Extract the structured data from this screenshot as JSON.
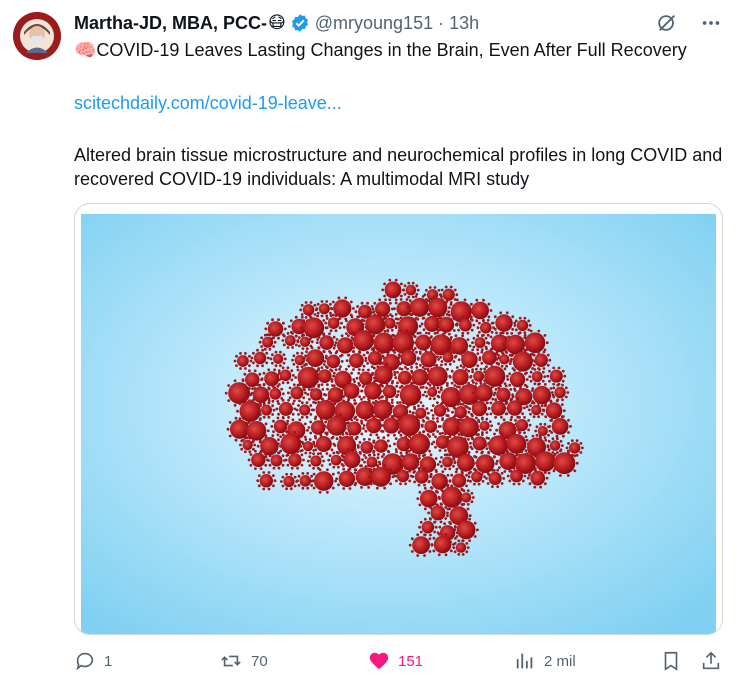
{
  "author": {
    "name": "Martha-JD, MBA, PCC-",
    "emoji": "😷",
    "handle": "@mryoung151",
    "time": "· 13h"
  },
  "tweet": {
    "title": "🧠COVID-19 Leaves Lasting Changes in the Brain, Even After Full Recovery",
    "link": "scitechdaily.com/covid-19-leave...",
    "body": "Altered brain tissue microstructure and neurochemical profiles in long COVID and recovered COVID-19 individuals: A multimodal MRI study"
  },
  "actions": {
    "replies": "1",
    "reposts": "70",
    "likes": "151",
    "views": "2 mil"
  },
  "colors": {
    "link": "#1d9bf0",
    "like": "#f91880",
    "virus": "#b3171c",
    "sky": "#7fd0f2"
  },
  "icons": [
    "verified-badge-icon",
    "grok-icon",
    "more-icon",
    "reply-icon",
    "repost-icon",
    "like-icon",
    "views-icon",
    "bookmark-icon",
    "share-icon"
  ]
}
